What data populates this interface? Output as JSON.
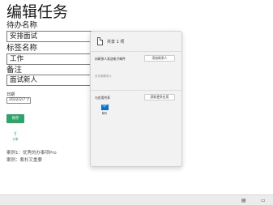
{
  "page": {
    "title": "编辑任务",
    "todo_name_label": "待办名称",
    "todo_name_value": "安排面试",
    "tag_name_label": "标签名称",
    "tag_name_value": "工作",
    "note_label": "备注",
    "note_value": "面试新人",
    "date_label": "日期",
    "date_value": "2022/2/7 ▽",
    "save_label": "保存",
    "share_label": "分享",
    "footer_line1": "案例1：优秀的办事项Pro",
    "footer_line2": "案例：紫杉又重要"
  },
  "share_panel": {
    "title": "共享 1 项",
    "section_people": "向联系人发送电子邮件",
    "add_contact_label": "添加联系人",
    "no_contacts_hint": "无可用联系人",
    "section_apps": "与应用共享",
    "get_apps_label": "获取更多应用",
    "apps": [
      {
        "icon": "mail-icon",
        "label": "邮件"
      }
    ]
  },
  "colors": {
    "accent": "#2da56a",
    "mail_blue": "#0f6fc6",
    "panel_bg": "#f2f2f2"
  }
}
